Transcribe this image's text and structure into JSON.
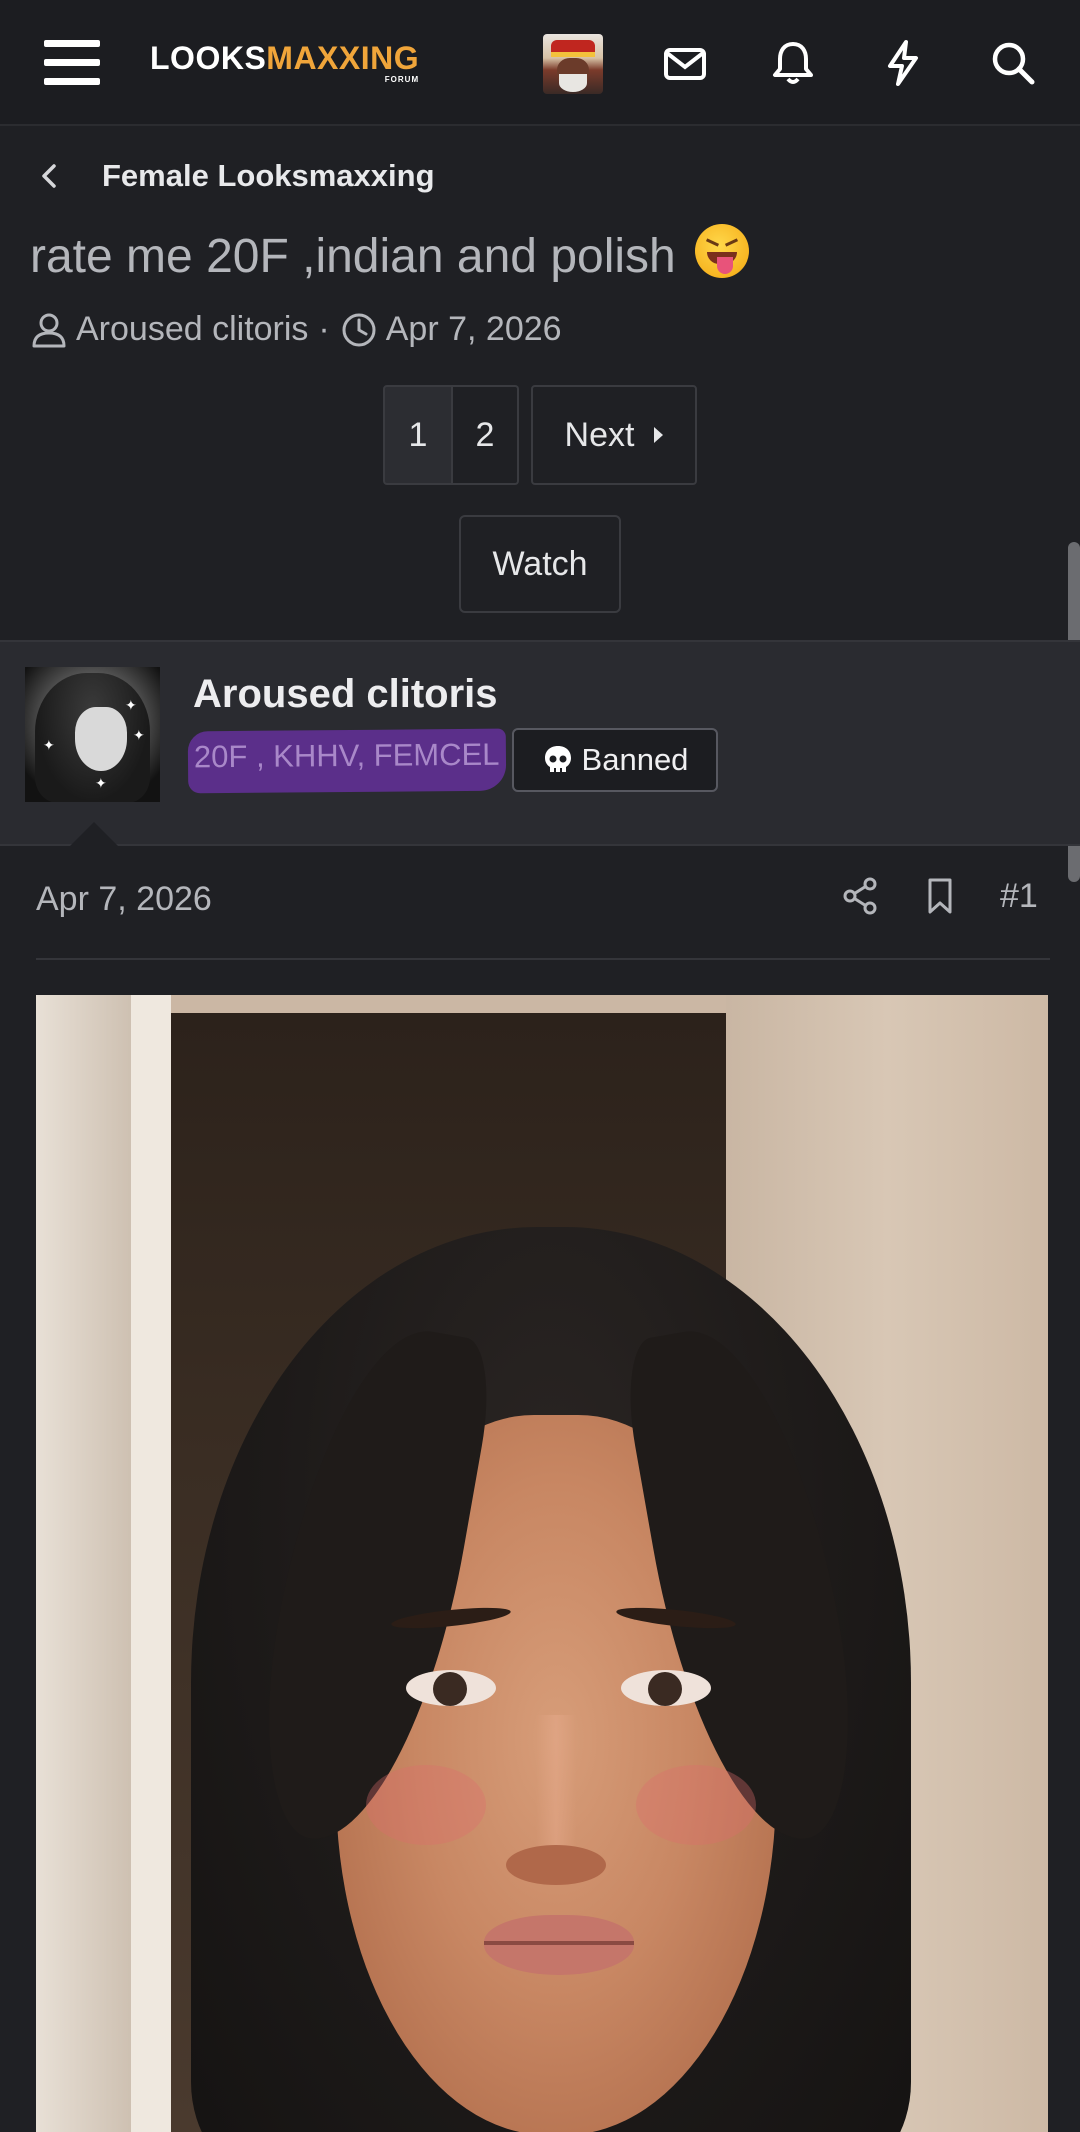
{
  "header": {
    "logo_white": "LOOKS",
    "logo_orange": "MAXXING",
    "logo_sub": "FORUM",
    "icons": [
      "menu-icon",
      "mail-icon",
      "bell-icon",
      "lightning-icon",
      "search-icon"
    ]
  },
  "thread": {
    "breadcrumb": "Female Looksmaxxing",
    "title": "rate me 20F ,indian and polish",
    "title_emoji": "squinting-face-with-tongue",
    "author": "Aroused clitoris",
    "separator": "·",
    "date": "Apr 7, 2026"
  },
  "pagination": {
    "page1": "1",
    "page2": "2",
    "next": "Next"
  },
  "watch_label": "Watch",
  "post": {
    "username": "Aroused clitoris",
    "user_title": "20F , KHHV, FEMCEL",
    "badge": "Banned",
    "date": "Apr 7, 2026",
    "number": "#1"
  },
  "colors": {
    "accent_orange": "#f0a53a",
    "user_title_purple": "#a988c9",
    "background": "#1f2024"
  }
}
